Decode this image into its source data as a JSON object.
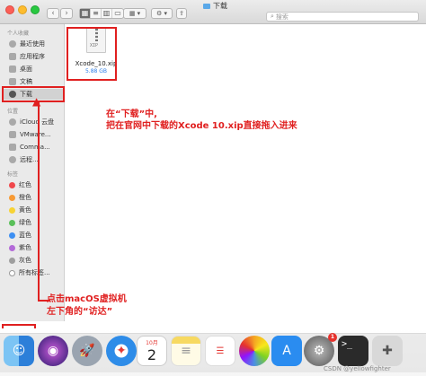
{
  "window": {
    "title": "下载",
    "search_placeholder": "搜索"
  },
  "toolbar": {
    "back_icon": "chevron-left-icon",
    "forward_icon": "chevron-right-icon",
    "view_modes": [
      "icon-view-icon",
      "list-view-icon",
      "column-view-icon",
      "gallery-view-icon"
    ],
    "group_icon": "group-by-icon",
    "action_icon": "gear-icon",
    "share_icon": "share-icon"
  },
  "sidebar": {
    "favorites_title": "个人收藏",
    "favorites": [
      {
        "label": "最近使用",
        "icon": "clock-icon"
      },
      {
        "label": "应用程序",
        "icon": "applications-icon"
      },
      {
        "label": "桌面",
        "icon": "desktop-icon"
      },
      {
        "label": "文稿",
        "icon": "documents-icon"
      },
      {
        "label": "下载",
        "icon": "download-icon"
      }
    ],
    "locations_title": "位置",
    "locations": [
      {
        "label": "iCloud 云盘",
        "icon": "cloud-icon"
      },
      {
        "label": "VMware...",
        "icon": "drive-icon"
      },
      {
        "label": "Comma...",
        "icon": "drive-icon"
      },
      {
        "label": "远程...",
        "icon": "network-icon"
      }
    ],
    "tags_title": "标签",
    "tags": [
      {
        "label": "红色",
        "color": "#f0474b"
      },
      {
        "label": "橙色",
        "color": "#f79a34"
      },
      {
        "label": "黄色",
        "color": "#f7d335"
      },
      {
        "label": "绿色",
        "color": "#5ac05a"
      },
      {
        "label": "蓝色",
        "color": "#3d8ff2"
      },
      {
        "label": "紫色",
        "color": "#b36ad8"
      },
      {
        "label": "灰色",
        "color": "#9e9e9e"
      },
      {
        "label": "所有标签...",
        "color": "#ffffff"
      }
    ]
  },
  "files": [
    {
      "name": "Xcode_10.xip",
      "size": "5.88 GB",
      "badge": "XIP"
    }
  ],
  "annotations": {
    "instruction_1_line1": "在“下载”中,",
    "instruction_1_line2": "把在官网中下载的Xcode 10.xip直接拖入进来",
    "instruction_2_line1": "点击macOS虚拟机",
    "instruction_2_line2": "左下角的“访达”",
    "color": "#e02020"
  },
  "dock": {
    "items": [
      {
        "name": "finder-icon",
        "color": "#3a8ee6"
      },
      {
        "name": "siri-icon",
        "color": "#3b2b8c"
      },
      {
        "name": "launchpad-icon",
        "color": "#9aa4b0"
      },
      {
        "name": "safari-icon",
        "color": "#2e8ce8"
      },
      {
        "name": "mail-icon",
        "color": "#4aa3f0"
      },
      {
        "name": "calendar-icon",
        "color": "#ffffff",
        "text": "2",
        "header": "10月"
      },
      {
        "name": "notes-icon",
        "color": "#f7d961"
      },
      {
        "name": "reminders-icon",
        "color": "#ffffff"
      },
      {
        "name": "photos-icon",
        "color": "#ffffff"
      },
      {
        "name": "messages-icon",
        "color": "#39c84b"
      },
      {
        "name": "facetime-icon",
        "color": "#39c84b"
      },
      {
        "name": "app-store-icon",
        "color": "#2a8cf0"
      },
      {
        "name": "system-preferences-icon",
        "color": "#8a8a8a",
        "badge": "1"
      },
      {
        "name": "terminal-icon",
        "color": "#2a2a2a",
        "text": ">_"
      },
      {
        "name": "disk-utility-icon",
        "color": "#d8d8d8"
      }
    ]
  },
  "watermark": "CSDN @yellowfighter"
}
